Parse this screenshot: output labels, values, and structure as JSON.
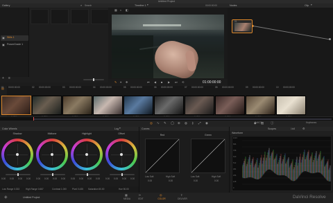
{
  "window": {
    "title": "Untitled Project"
  },
  "gallery": {
    "title": "Gallery",
    "timeline_selector": "Timeline 1",
    "search_placeholder": "Search",
    "albums": [
      {
        "label": "Stills 1"
      },
      {
        "label": "PowerGrade 1"
      }
    ],
    "icons": {
      "add": "+",
      "menu": "≡"
    }
  },
  "viewer": {
    "timecode_top": "00:00:00:00",
    "timecode_main": "01:00:00:00",
    "transport_icons": [
      "⏮",
      "◀",
      "■",
      "▶",
      "⏭",
      "⟲"
    ]
  },
  "nodes": {
    "title": "Nodes",
    "clip_label": "Clip",
    "node_number": "01"
  },
  "timeline": {
    "clips": [
      {
        "number": "01",
        "timecode": "00:00:00:00",
        "codec": "H.264",
        "colors": [
          "#3a2a22",
          "#6a4a3a",
          "#2a1c16"
        ]
      },
      {
        "number": "02",
        "timecode": "00:00:00:00",
        "codec": "H.264",
        "colors": [
          "#202a28",
          "#6a5e50",
          "#1a1e1c"
        ]
      },
      {
        "number": "03",
        "timecode": "00:00:00:00",
        "codec": "H.264",
        "colors": [
          "#4a3a2a",
          "#8a7a62",
          "#2a2218"
        ]
      },
      {
        "number": "04",
        "timecode": "00:00:00:00",
        "codec": "H.264",
        "colors": [
          "#5a6a6a",
          "#c8b8b0",
          "#3a3030"
        ]
      },
      {
        "number": "05",
        "timecode": "00:00:00:00",
        "codec": "H.264",
        "colors": [
          "#22364a",
          "#5a7aa0",
          "#101820"
        ]
      },
      {
        "number": "06",
        "timecode": "00:00:00:00",
        "codec": "H.264",
        "colors": [
          "#242424",
          "#6a6a6a",
          "#141414"
        ]
      },
      {
        "number": "07",
        "timecode": "00:00:00:00",
        "codec": "H.264",
        "colors": [
          "#2a2a2a",
          "#6a5a52",
          "#1a1a1a"
        ]
      },
      {
        "number": "08",
        "timecode": "00:00:00:00",
        "codec": "H.264",
        "colors": [
          "#3a2a28",
          "#7a5e58",
          "#201614"
        ]
      },
      {
        "number": "09",
        "timecode": "00:00:00:00",
        "codec": "H.264",
        "colors": [
          "#5a4a3a",
          "#9a8a72",
          "#2a2018"
        ]
      },
      {
        "number": "10",
        "timecode": "00:00:00:00",
        "codec": "H.264",
        "colors": [
          "#c8c0b0",
          "#e8e0d0",
          "#8a8070"
        ]
      }
    ]
  },
  "color_wheels": {
    "title": "Color Wheels",
    "mode": "Log",
    "wheels": [
      {
        "label": "Shadow",
        "values": [
          "0.00",
          "0.00",
          "0.00",
          "0.00"
        ]
      },
      {
        "label": "Midtone",
        "values": [
          "0.00",
          "0.00",
          "0.00",
          "0.00"
        ]
      },
      {
        "label": "Highlight",
        "values": [
          "0.00",
          "0.00",
          "0.00",
          "0.00"
        ]
      },
      {
        "label": "Offset",
        "values": [
          "0.00",
          "0.00",
          "0.00",
          "0.00"
        ]
      }
    ],
    "footer": {
      "low_range": "Low Range 0.333",
      "high_range": "High Range 0.667",
      "contrast": "Contrast 1.000",
      "pivot": "Pivot 0.435",
      "saturation": "Saturation 50.00",
      "hue": "Hue 50.00"
    }
  },
  "curves": {
    "title": "Curves",
    "panels": [
      {
        "label": "Red",
        "low": "Low Soft",
        "high": "High Soft",
        "low_val": "0.00",
        "high_val": "0.00"
      },
      {
        "label": "Green",
        "low": "Low Soft",
        "high": "High Soft",
        "low_val": "0.00",
        "high_val": "0.00"
      }
    ]
  },
  "scopes": {
    "soft_clip_label": "Soft Clip",
    "keyframes_label": "Keyframes",
    "scopes_label": "Scopes",
    "mode": "Waveform",
    "zoom": "1to8",
    "scale": [
      "1023",
      "896",
      "768",
      "640",
      "512",
      "384",
      "256",
      "128",
      "0"
    ]
  },
  "pages": [
    {
      "label": "MEDIA"
    },
    {
      "label": "EDIT"
    },
    {
      "label": "COLOR"
    },
    {
      "label": "DELIVER"
    }
  ],
  "footer": {
    "project": "Untitled Project",
    "app_name": "DaVinci Resolve"
  },
  "colors": {
    "accent": "#e0892b",
    "background": "#141414"
  }
}
